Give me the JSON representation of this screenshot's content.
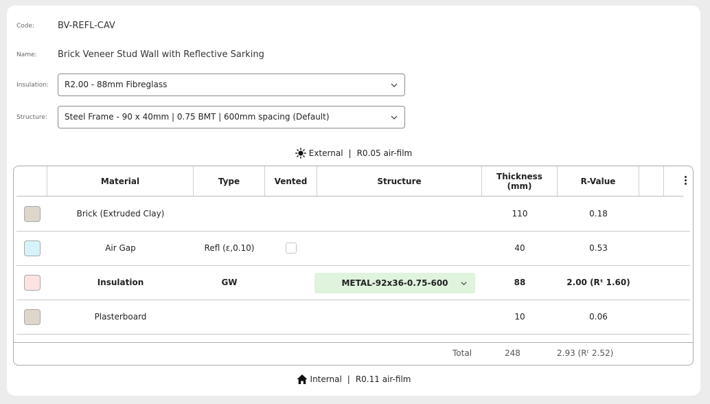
{
  "form": {
    "code_label": "Code:",
    "code_value": "BV-REFL-CAV",
    "name_label": "Name:",
    "name_value": "Brick Veneer Stud Wall with Reflective Sarking",
    "insulation_label": "Insulation:",
    "insulation_value": "R2.00 - 88mm Fibreglass",
    "structure_label": "Structure:",
    "structure_value": "Steel Frame - 90 x 40mm | 0.75 BMT | 600mm spacing (Default)"
  },
  "external": {
    "label": "External",
    "sep": "|",
    "film": "R0.05 air-film",
    "icon": "sun-icon"
  },
  "internal": {
    "label": "Internal",
    "sep": "|",
    "film": "R0.11 air-film",
    "icon": "home-icon"
  },
  "table": {
    "headers": {
      "material": "Material",
      "type": "Type",
      "vented": "Vented",
      "structure": "Structure",
      "thickness": "Thickness (mm)",
      "rvalue": "R-Value"
    },
    "rows": [
      {
        "color": "#ded6cb",
        "material": "Brick (Extruded Clay)",
        "type": "",
        "vented": null,
        "structure": "",
        "thickness": "110",
        "rvalue": "0.18",
        "bold": false
      },
      {
        "color": "#d6f3fa",
        "material": "Air Gap",
        "type": "Refl (ε,0.10)",
        "vented": false,
        "structure": "",
        "thickness": "40",
        "rvalue": "0.53",
        "bold": false
      },
      {
        "color": "#fde2e2",
        "material": "Insulation",
        "type": "GW",
        "vented": null,
        "structure": "METAL-92x36-0.75-600",
        "thickness": "88",
        "rvalue": "2.00 (Rᵗ 1.60)",
        "bold": true
      },
      {
        "color": "#ded6cb",
        "material": "Plasterboard",
        "type": "",
        "vented": null,
        "structure": "",
        "thickness": "10",
        "rvalue": "0.06",
        "bold": false
      }
    ],
    "total": {
      "label": "Total",
      "thickness": "248",
      "rvalue": "2.93 (Rᵗ 2.52)"
    }
  }
}
